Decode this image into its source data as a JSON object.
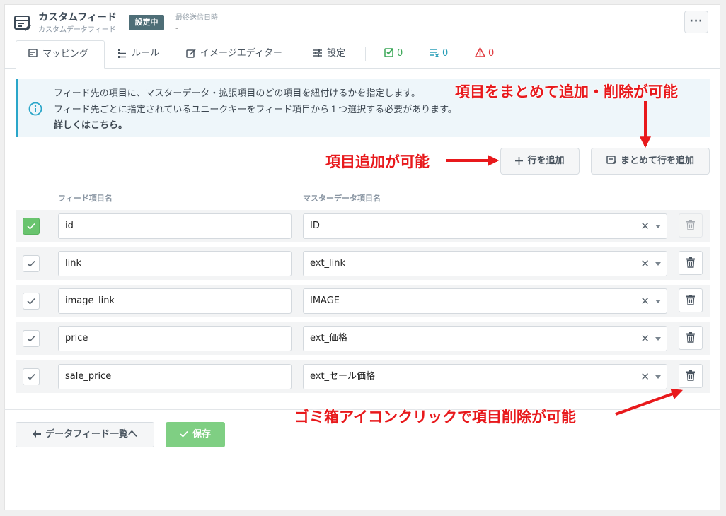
{
  "header": {
    "title": "カスタムフィード",
    "subtitle": "カスタムデータフィード",
    "status_badge": "設定中",
    "last_sent_label": "最終送信日時",
    "last_sent_value": "-",
    "more_label": "···"
  },
  "tabs": [
    {
      "label": "マッピング",
      "icon": "mapping-icon",
      "active": true
    },
    {
      "label": "ルール",
      "icon": "rule-icon",
      "active": false
    },
    {
      "label": "イメージエディター",
      "icon": "image-editor-icon",
      "active": false
    },
    {
      "label": "設定",
      "icon": "settings-sliders-icon",
      "active": false
    }
  ],
  "counts": [
    {
      "value": "0",
      "icon": "check-list-icon",
      "color": "#3aa757"
    },
    {
      "value": "0",
      "icon": "list-x-icon",
      "color": "#2a9fb8"
    },
    {
      "value": "0",
      "icon": "warning-icon",
      "color": "#e0393e"
    }
  ],
  "info": {
    "line1": "フィード先の項目に、マスターデータ・拡張項目のどの項目を紐付けるかを指定します。",
    "line2": "フィード先ごとに指定されているユニークキーをフィード項目から１つ選択する必要があります。",
    "link": "詳しくはこちら。",
    "accent_color": "#2aa6c9"
  },
  "actions": {
    "add_row_label": "行を追加",
    "bulk_add_label": "まとめて行を追加"
  },
  "table": {
    "col_feed": "フィード項目名",
    "col_master": "マスターデータ項目名",
    "rows": [
      {
        "checked": true,
        "feed": "id",
        "master": "ID",
        "delete_enabled": false
      },
      {
        "checked": false,
        "feed": "link",
        "master": "ext_link",
        "delete_enabled": true
      },
      {
        "checked": false,
        "feed": "image_link",
        "master": "IMAGE",
        "delete_enabled": true
      },
      {
        "checked": false,
        "feed": "price",
        "master": "ext_価格",
        "delete_enabled": true
      },
      {
        "checked": false,
        "feed": "sale_price",
        "master": "ext_セール価格",
        "delete_enabled": true
      }
    ]
  },
  "footer": {
    "back_label": "データフィード一覧へ",
    "save_label": "保存"
  },
  "annotations": {
    "bulk": "項目をまとめて追加・削除が可能",
    "add": "項目追加が可能",
    "trash": "ゴミ箱アイコンクリックで項目削除が可能",
    "color": "#e8191c"
  }
}
